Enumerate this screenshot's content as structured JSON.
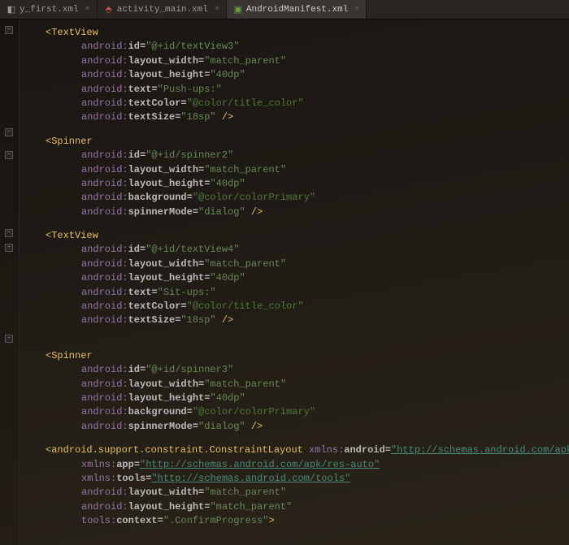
{
  "tabs": [
    {
      "label": "y_first.xml",
      "active": false,
      "icon_color": "#888"
    },
    {
      "label": "activity_main.xml",
      "active": false,
      "icon_color": "#c75450"
    },
    {
      "label": "AndroidManifest.xml",
      "active": true,
      "icon_color": "#6a9e3e"
    }
  ],
  "code": {
    "textview1": {
      "tag": "<TextView",
      "id_attr": "android:",
      "id_name": "id=",
      "id_val": "\"@+id/textView3\"",
      "lw_attr": "android:",
      "lw_name": "layout_width=",
      "lw_val": "\"match_parent\"",
      "lh_attr": "android:",
      "lh_name": "layout_height=",
      "lh_val": "\"40dp\"",
      "tx_attr": "android:",
      "tx_name": "text=",
      "tx_val": "\"Push-ups:\"",
      "tc_attr": "android:",
      "tc_name": "textColor=",
      "tc_val": "\"@color/title_color\"",
      "ts_attr": "android:",
      "ts_name": "textSize=",
      "ts_val": "\"18sp\"",
      "close": " />"
    },
    "spinner1": {
      "tag": "<Spinner",
      "id_attr": "android:",
      "id_name": "id=",
      "id_val": "\"@+id/spinner2\"",
      "lw_attr": "android:",
      "lw_name": "layout_width=",
      "lw_val": "\"match_parent\"",
      "lh_attr": "android:",
      "lh_name": "layout_height=",
      "lh_val": "\"40dp\"",
      "bg_attr": "android:",
      "bg_name": "background=",
      "bg_val": "\"@color/colorPrimary\"",
      "sm_attr": "android:",
      "sm_name": "spinnerMode=",
      "sm_val": "\"dialog\"",
      "close": " />"
    },
    "textview2": {
      "tag": "<TextView",
      "id_attr": "android:",
      "id_name": "id=",
      "id_val": "\"@+id/textView4\"",
      "lw_attr": "android:",
      "lw_name": "layout_width=",
      "lw_val": "\"match_parent\"",
      "lh_attr": "android:",
      "lh_name": "layout_height=",
      "lh_val": "\"40dp\"",
      "tx_attr": "android:",
      "tx_name": "text=",
      "tx_val": "\"Sit-ups:\"",
      "tc_attr": "android:",
      "tc_name": "textColor=",
      "tc_val": "\"@color/title_color\"",
      "ts_attr": "android:",
      "ts_name": "textSize=",
      "ts_val": "\"18sp\"",
      "close": " />"
    },
    "spinner2": {
      "tag": "<Spinner",
      "id_attr": "android:",
      "id_name": "id=",
      "id_val": "\"@+id/spinner3\"",
      "lw_attr": "android:",
      "lw_name": "layout_width=",
      "lw_val": "\"match_parent\"",
      "lh_attr": "android:",
      "lh_name": "layout_height=",
      "lh_val": "\"40dp\"",
      "bg_attr": "android:",
      "bg_name": "background=",
      "bg_val": "\"@color/colorPrimary\"",
      "sm_attr": "android:",
      "sm_name": "spinnerMode=",
      "sm_val": "\"dialog\"",
      "close": " />"
    },
    "constraint": {
      "tag": "<android.support.constraint.ConstraintLayout",
      "ns1a": " xmlns:",
      "ns1n": "android=",
      "ns1v": "\"http://schemas.android.com/apk/res/and",
      "ns2a": "xmlns:",
      "ns2n": "app=",
      "ns2v": "\"http://schemas.android.com/apk/res-auto\"",
      "ns3a": "xmlns:",
      "ns3n": "tools=",
      "ns3v": "\"http://schemas.android.com/tools\"",
      "lw_attr": "android:",
      "lw_name": "layout_width=",
      "lw_val": "\"match_parent\"",
      "lh_attr": "android:",
      "lh_name": "layout_height=",
      "lh_val": "\"match_parent\"",
      "ctx_attr": "tools:",
      "ctx_name": "context=",
      "ctx_val": "\".ConfirmProgress\"",
      "ctx_close": ">"
    }
  }
}
